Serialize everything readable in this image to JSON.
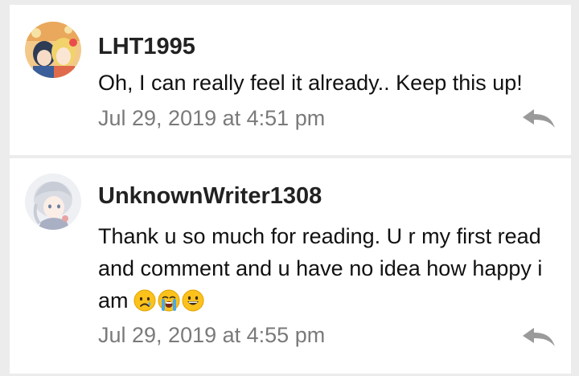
{
  "colors": {
    "page_background": "#ececec",
    "card_background": "#ffffff",
    "username": "#222222",
    "text": "#111111",
    "timestamp": "#7a7a7a",
    "reply_icon": "#9a9a9a"
  },
  "comments": [
    {
      "username": "LHT1995",
      "text": "Oh, I can really feel it already.. Keep this up!",
      "timestamp": "Jul 29, 2019 at 4:51 pm",
      "avatar_icon": "anime-avatar-icon",
      "reply_icon": "reply-arrow-icon"
    },
    {
      "username": "UnknownWriter1308",
      "text": "Thank u so much for reading. U r my first read and comment and u have no idea how happy i am",
      "emojis": [
        "crying-face-emoji",
        "loudly-crying-face-emoji",
        "grinning-face-emoji"
      ],
      "timestamp": "Jul 29, 2019 at 4:55 pm",
      "avatar_icon": "anime-avatar-icon",
      "reply_icon": "reply-arrow-icon"
    }
  ]
}
